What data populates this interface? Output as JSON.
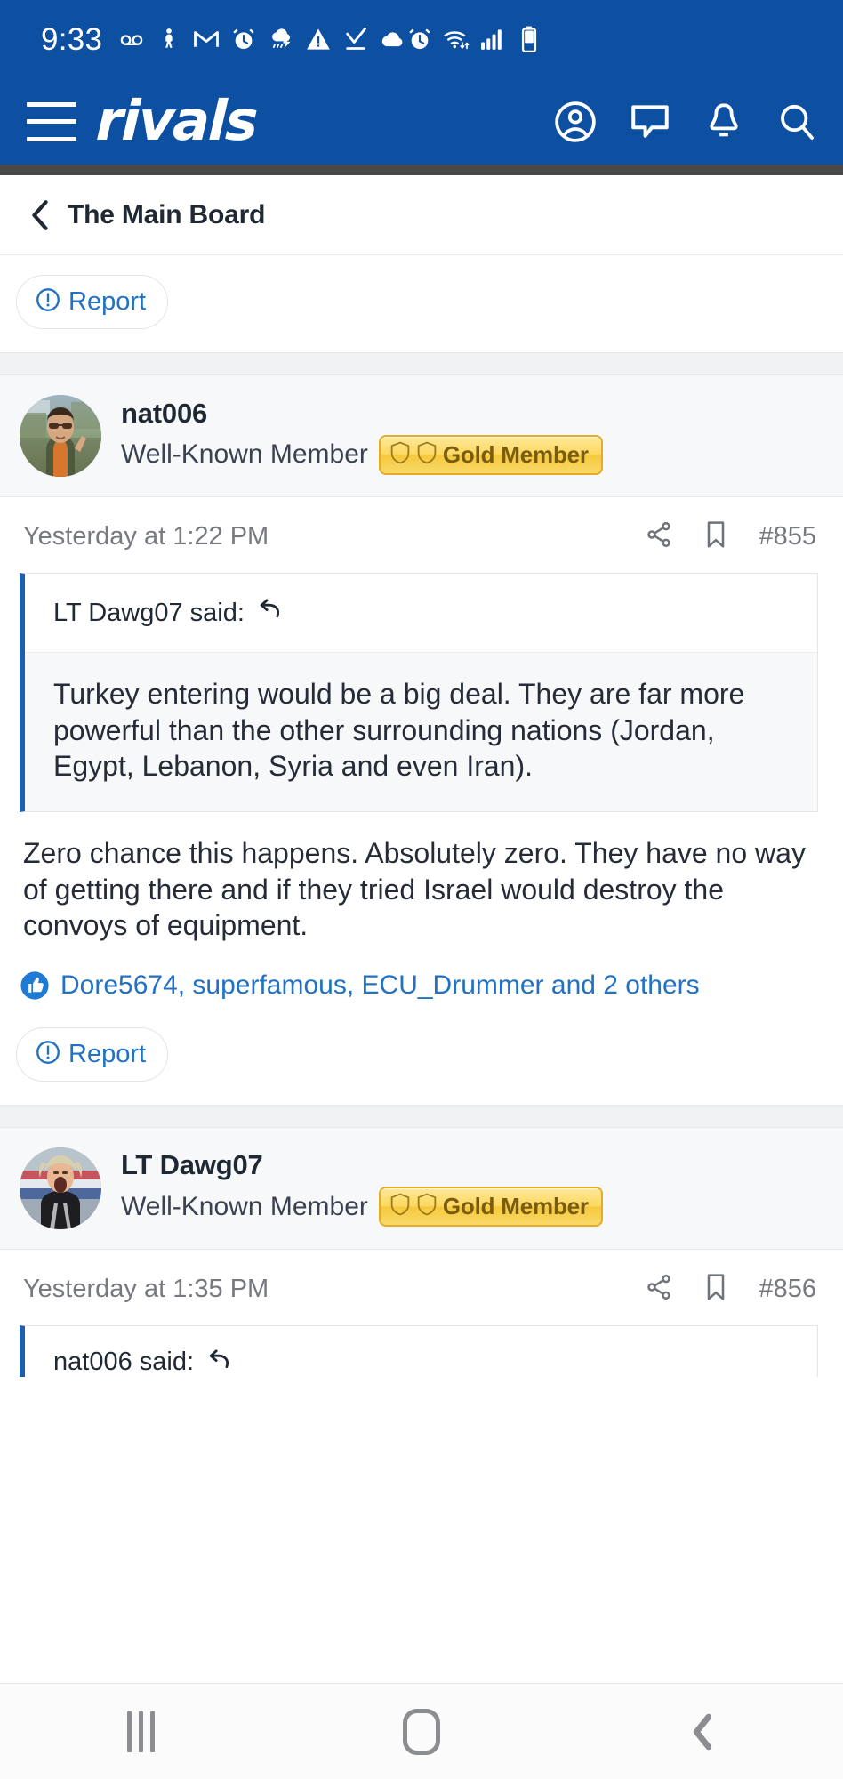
{
  "status_bar": {
    "time": "9:33",
    "left_icons": [
      "voicemail-icon",
      "fitness-icon",
      "gmail-icon",
      "alarm-icon",
      "weather-alert-icon",
      "warning-icon",
      "download-check-icon",
      "cloud-icon"
    ],
    "right_icons": [
      "alarm-icon",
      "wifi-icon",
      "cellular-signal-icon",
      "battery-icon"
    ]
  },
  "app_bar": {
    "brand": "rivals",
    "menu_label": "menu-icon",
    "actions": [
      "account-icon",
      "conversations-icon",
      "alerts-icon",
      "search-icon"
    ]
  },
  "breadcrumb": {
    "back_label": "back-chevron",
    "title": "The Main Board"
  },
  "colors": {
    "brand_blue": "#0d4fa0",
    "link_blue": "#2171c4",
    "quote_accent": "#1b5fae",
    "gold_badge": "#f5c93d",
    "gold_badge_text": "#7a5c10",
    "muted_text": "#76797f",
    "body_text": "#252c38"
  },
  "top_report": {
    "label": "Report",
    "icon": "report-exclamation-icon"
  },
  "posts": [
    {
      "username": "nat006",
      "user_title": "Well-Known Member",
      "badge": "Gold Member",
      "avatar_alt": "avatar-nat006",
      "date": "Yesterday at 1:22 PM",
      "post_number": "#855",
      "share_icon": "share-icon",
      "bookmark_icon": "bookmark-icon",
      "quote": {
        "attribution": "LT Dawg07 said:",
        "jump_icon": "jump-to-quote-icon",
        "text": "Turkey entering would be a big deal. They are far more powerful than the other surrounding nations (Jordan, Egypt, Lebanon, Syria and even Iran)."
      },
      "body": "Zero chance this happens. Absolutely zero. They have no way of getting there and if they tried Israel would destroy the convoys of equipment.",
      "reactions": {
        "icon": "thumbs-up-icon",
        "text": "Dore5674, superfamous, ECU_Drummer and 2 others"
      },
      "report": {
        "label": "Report",
        "icon": "report-exclamation-icon"
      }
    },
    {
      "username": "LT Dawg07",
      "user_title": "Well-Known Member",
      "badge": "Gold Member",
      "avatar_alt": "avatar-lt-dawg07",
      "date": "Yesterday at 1:35 PM",
      "post_number": "#856",
      "share_icon": "share-icon",
      "bookmark_icon": "bookmark-icon",
      "quote": {
        "attribution": "nat006 said:",
        "jump_icon": "jump-to-quote-icon",
        "text": ""
      }
    }
  ],
  "nav_bar": {
    "recents_label": "recents-icon",
    "home_label": "home-icon",
    "back_label": "back-icon"
  }
}
